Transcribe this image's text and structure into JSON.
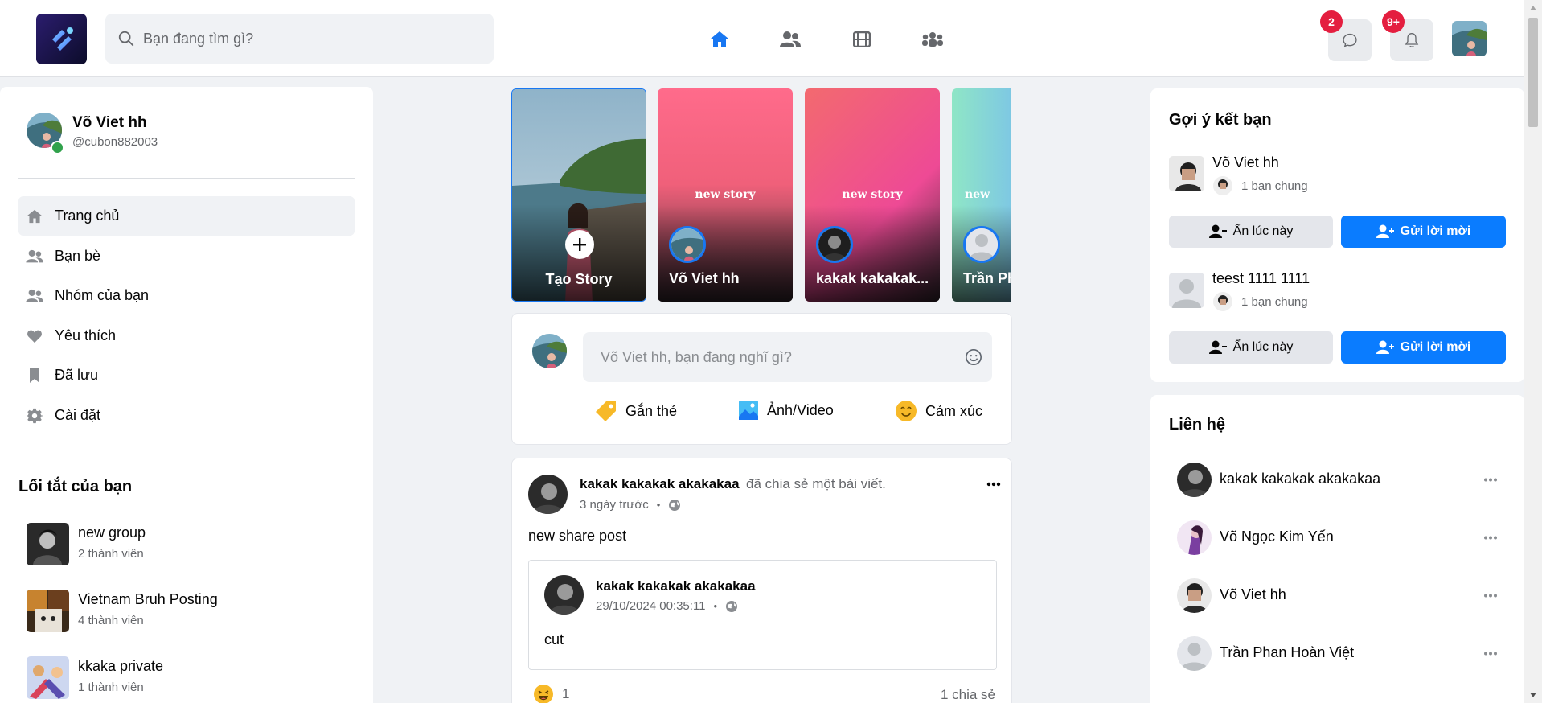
{
  "header": {
    "search_placeholder": "Bạn đang tìm gì?",
    "messages_badge": "2",
    "notifications_badge": "9+",
    "accent": "#1877f2"
  },
  "sidebar": {
    "user_name": "Võ Viet hh",
    "username": "@cubon882003",
    "items": [
      {
        "label": "Trang chủ",
        "icon": "home-icon"
      },
      {
        "label": "Bạn bè",
        "icon": "friends-icon"
      },
      {
        "label": "Nhóm của bạn",
        "icon": "groups-icon"
      },
      {
        "label": "Yêu thích",
        "icon": "heart-icon"
      },
      {
        "label": "Đã lưu",
        "icon": "bookmark-icon"
      },
      {
        "label": "Cài đặt",
        "icon": "gear-icon"
      }
    ],
    "shortcuts_title": "Lối tắt của bạn",
    "shortcuts": [
      {
        "name": "new group",
        "members": "2 thành viên"
      },
      {
        "name": "Vietnam Bruh Posting",
        "members": "4 thành viên"
      },
      {
        "name": "kkaka private",
        "members": "1 thành viên"
      }
    ]
  },
  "stories": {
    "create_label": "Tạo Story",
    "items": [
      {
        "text": "new story",
        "name": "Võ Viet hh"
      },
      {
        "text": "new story",
        "name": "kakak kakakak..."
      },
      {
        "text": "new",
        "name": "Trần Pha"
      }
    ]
  },
  "composer": {
    "placeholder": "Võ Viet hh, bạn đang nghĩ gì?",
    "actions": [
      "Gắn thẻ",
      "Ảnh/Video",
      "Cảm xúc"
    ]
  },
  "post": {
    "author": "kakak kakakak akakakaa",
    "action": "đã chia sẻ một bài viết.",
    "time": "3 ngày trước",
    "dot": "•",
    "text": "new share post",
    "shared": {
      "author": "kakak kakakak akakakaa",
      "time": "29/10/2024 00:35:11",
      "text": "cut"
    },
    "reaction_count": "1",
    "shares": "1 chia sẻ"
  },
  "suggestions": {
    "title": "Gợi ý kết bạn",
    "items": [
      {
        "name": "Võ Viet hh",
        "mutual": "1 bạn chung"
      },
      {
        "name": "teest 1111 1111",
        "mutual": "1 bạn chung"
      }
    ],
    "hide_label": "Ẩn lúc này",
    "invite_label": "Gửi lời mời"
  },
  "contacts": {
    "title": "Liên hệ",
    "items": [
      {
        "name": "kakak kakakak akakakaa"
      },
      {
        "name": "Võ Ngọc Kim Yến"
      },
      {
        "name": "Võ Viet hh"
      },
      {
        "name": "Trần Phan Hoàn Việt"
      }
    ]
  }
}
